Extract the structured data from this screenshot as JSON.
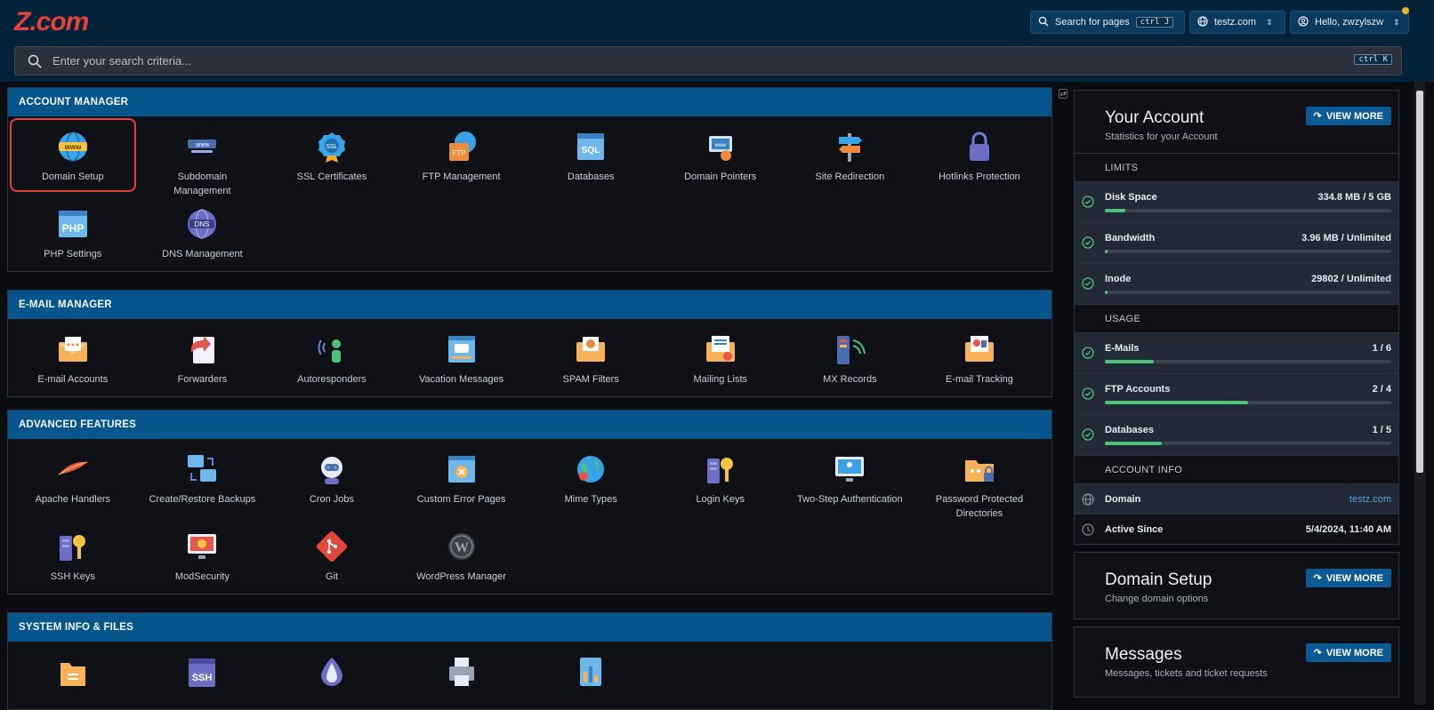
{
  "header": {
    "logo": "Z.com",
    "search_pages_label": "Search for pages",
    "search_pages_kbd": "ctrl J",
    "domain_select": "testz.com",
    "user_label": "Hello, zwzylszw"
  },
  "search": {
    "placeholder": "Enter your search criteria...",
    "kbd": "ctrl K"
  },
  "sections": [
    {
      "title": "ACCOUNT MANAGER",
      "items": [
        {
          "label": "Domain Setup",
          "icon": "globe-www-icon",
          "selected": true
        },
        {
          "label": "Subdomain Management",
          "icon": "subdomain-icon"
        },
        {
          "label": "SSL Certificates",
          "icon": "ssl-badge-icon"
        },
        {
          "label": "FTP Management",
          "icon": "ftp-folder-icon"
        },
        {
          "label": "Databases",
          "icon": "sql-database-icon"
        },
        {
          "label": "Domain Pointers",
          "icon": "domain-pointer-icon"
        },
        {
          "label": "Site Redirection",
          "icon": "signpost-icon"
        },
        {
          "label": "Hotlinks Protection",
          "icon": "padlock-icon"
        },
        {
          "label": "PHP Settings",
          "icon": "php-icon"
        },
        {
          "label": "DNS Management",
          "icon": "dns-icon"
        }
      ]
    },
    {
      "title": "E-MAIL MANAGER",
      "items": [
        {
          "label": "E-mail Accounts",
          "icon": "email-envelope-icon"
        },
        {
          "label": "Forwarders",
          "icon": "forward-icon"
        },
        {
          "label": "Autoresponders",
          "icon": "autoresponder-icon"
        },
        {
          "label": "Vacation Messages",
          "icon": "vacation-message-icon"
        },
        {
          "label": "SPAM Filters",
          "icon": "spam-filter-icon"
        },
        {
          "label": "Mailing Lists",
          "icon": "mailing-list-icon"
        },
        {
          "label": "MX Records",
          "icon": "mx-record-icon"
        },
        {
          "label": "E-mail Tracking",
          "icon": "email-tracking-icon"
        }
      ]
    },
    {
      "title": "ADVANCED FEATURES",
      "items": [
        {
          "label": "Apache Handlers",
          "icon": "apache-feather-icon"
        },
        {
          "label": "Create/Restore Backups",
          "icon": "backup-icon"
        },
        {
          "label": "Cron Jobs",
          "icon": "cron-robot-icon"
        },
        {
          "label": "Custom Error Pages",
          "icon": "error-page-icon"
        },
        {
          "label": "Mime Types",
          "icon": "mime-globe-icon"
        },
        {
          "label": "Login Keys",
          "icon": "login-key-icon"
        },
        {
          "label": "Two-Step Authentication",
          "icon": "two-step-auth-icon"
        },
        {
          "label": "Password Protected Directories",
          "icon": "protected-folder-icon"
        },
        {
          "label": "SSH Keys",
          "icon": "ssh-key-icon"
        },
        {
          "label": "ModSecurity",
          "icon": "modsecurity-icon"
        },
        {
          "label": "Git",
          "icon": "git-icon"
        },
        {
          "label": "WordPress Manager",
          "icon": "wordpress-icon"
        }
      ]
    },
    {
      "title": "SYSTEM INFO & FILES",
      "items": [
        {
          "label": "",
          "icon": "file-manager-icon"
        },
        {
          "label": "",
          "icon": "ssh-terminal-icon"
        },
        {
          "label": "",
          "icon": "onion-icon"
        },
        {
          "label": "",
          "icon": "printer-icon"
        },
        {
          "label": "",
          "icon": "stats-icon"
        }
      ]
    }
  ],
  "account": {
    "title": "Your Account",
    "subtitle": "Statistics for your Account",
    "view_more": "VIEW MORE",
    "limits_label": "LIMITS",
    "limits": [
      {
        "name": "Disk Space",
        "value": "334.8 MB / 5 GB",
        "fraction": 0.07
      },
      {
        "name": "Bandwidth",
        "value": "3.96 MB / Unlimited",
        "fraction": 0.01
      },
      {
        "name": "Inode",
        "value": "29802 / Unlimited",
        "fraction": 0.01
      }
    ],
    "usage_label": "USAGE",
    "usage": [
      {
        "name": "E-Mails",
        "value": "1 / 6",
        "fraction": 0.17
      },
      {
        "name": "FTP Accounts",
        "value": "2 / 4",
        "fraction": 0.5
      },
      {
        "name": "Databases",
        "value": "1 / 5",
        "fraction": 0.2
      }
    ],
    "info_label": "ACCOUNT INFO",
    "info": {
      "domain_label": "Domain",
      "domain_value": "testz.com",
      "since_label": "Active Since",
      "since_value": "5/4/2024, 11:40 AM"
    }
  },
  "domain_card": {
    "title": "Domain Setup",
    "subtitle": "Change domain options",
    "view_more": "VIEW MORE"
  },
  "messages_card": {
    "title": "Messages",
    "subtitle": "Messages, tickets and ticket requests",
    "view_more": "VIEW MORE"
  },
  "colors": {
    "brand": "#e0443a",
    "section_header": "#07558d",
    "progress": "#4cc37a",
    "accent_button": "#0b5a94"
  }
}
